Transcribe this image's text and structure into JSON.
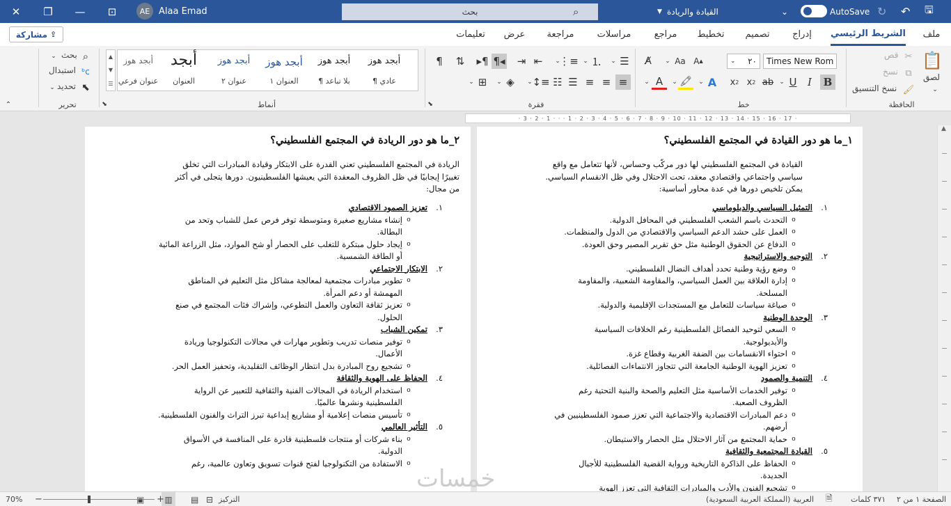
{
  "titlebar": {
    "close": "✕",
    "restore": "❐",
    "minimize": "—",
    "options": "⊡",
    "user_initials": "AE",
    "user_name": "Alaa Emad",
    "search_placeholder": "بحث",
    "doc_title": "القيادة والريادة",
    "autosave": "AutoSave"
  },
  "tabs": [
    "ملف",
    "الشريط الرئيسي",
    "إدراج",
    "تصميم",
    "تخطيط",
    "مراجع",
    "مراسلات",
    "مراجعة",
    "عرض",
    "تعليمات"
  ],
  "share": "مشاركة",
  "clipboard": {
    "paste": "لصق",
    "cut": "قص",
    "copy": "نسخ",
    "format_painter": "نسخ التنسيق",
    "label": "الحافظة"
  },
  "font": {
    "name": "Times New Rom",
    "size": "٢٠",
    "label": "خط"
  },
  "paragraph": {
    "label": "فقرة"
  },
  "styles": {
    "label": "أنماط",
    "items": [
      {
        "preview": "أبجد هوز",
        "name": "¶ عادي"
      },
      {
        "preview": "أبجد هوز",
        "name": "¶ بلا تباعد"
      },
      {
        "preview": "أبجد هوز",
        "name": "العنوان ١"
      },
      {
        "preview": "أبجد هوز",
        "name": "عنوان ٢"
      },
      {
        "preview": "أبجد",
        "name": "العنوان"
      },
      {
        "preview": "أبجد هوز",
        "name": "عنوان فرعي"
      }
    ]
  },
  "editing": {
    "find": "بحث",
    "replace": "استبدال",
    "select": "تحديد",
    "label": "تحرير"
  },
  "ruler_text": "· 3 · 2 · 1 · · · 1 · 2 · 3 · 4 · 5 · 6 · 7 · 8 · 9 · 10 · 11 · 12 · 13 · 14 · 15 · 16 · 17 ·",
  "page1": {
    "title": "١_ما هو دور القيادة في المجتمع الفلسطيني؟",
    "intro": "القيادة في المجتمع الفلسطيني لها دور مركّب وحساس، لأنها تتعامل مع واقع سياسي واجتماعي واقتصادي معقد، تحت الاحتلال وفي ظل الانقسام السياسي. يمكن تلخيص دورها في عدة محاور أساسية:",
    "sections": [
      {
        "num": "١.",
        "title": "التمثيل السياسي والدبلوماسي",
        "bullets": [
          "التحدث باسم الشعب الفلسطيني في المحافل الدولية.",
          "العمل على حشد الدعم السياسي والاقتصادي من الدول والمنظمات.",
          "الدفاع عن الحقوق الوطنية مثل حق تقرير المصير وحق العودة."
        ]
      },
      {
        "num": "٢.",
        "title": "التوجيه والاستراتيجية",
        "bullets": [
          "وضع رؤية وطنية تحدد أهداف النضال الفلسطيني.",
          "إدارة العلاقة بين العمل السياسي، والمقاومة الشعبية، والمقاومة المسلحة.",
          "صياغة سياسات للتعامل مع المستجدات الإقليمية والدولية."
        ]
      },
      {
        "num": "٣.",
        "title": "الوحدة الوطنية",
        "bullets": [
          "السعي لتوحيد الفصائل الفلسطينية رغم الخلافات السياسية والأيديولوجية.",
          "احتواء الانقسامات بين الضفة الغربية وقطاع غزة.",
          "تعزيز الهوية الوطنية الجامعة التي تتجاوز الانتماءات الفصائلية."
        ]
      },
      {
        "num": "٤.",
        "title": "التنمية والصمود",
        "bullets": [
          "توفير الخدمات الأساسية مثل التعليم والصحة والبنية التحتية رغم الظروف الصعبة.",
          "دعم المبادرات الاقتصادية والاجتماعية التي تعزز صمود الفلسطينيين في أرضهم.",
          "حماية المجتمع من آثار الاحتلال مثل الحصار والاستيطان."
        ]
      },
      {
        "num": "٥.",
        "title": "القيادة المجتمعية والثقافية",
        "bullets": [
          "الحفاظ على الذاكرة التاريخية ورواية القضية الفلسطينية للأجيال الجديدة.",
          "تشجيع الفنون والأدب والمبادرات الثقافية التي تعزز الهوية"
        ]
      }
    ]
  },
  "page2": {
    "title": "٢_ما هو دور الريادة في المجتمع الفلسطيني؟",
    "intro": "الريادة في المجتمع الفلسطيني تعني القدرة على الابتكار وقيادة المبادرات التي تخلق تغييرًا إيجابيًا في ظل الظروف المعقدة التي يعيشها الفلسطينيون. دورها يتجلى في أكثر من مجال:",
    "sections": [
      {
        "num": "١.",
        "title": "تعزيز الصمود الاقتصادي",
        "bullets": [
          "إنشاء مشاريع صغيرة ومتوسطة توفر فرص عمل للشباب وتحد من البطالة.",
          "إيجاد حلول مبتكرة للتغلب على الحصار أو شح الموارد، مثل الزراعة المائية أو الطاقة الشمسية."
        ]
      },
      {
        "num": "٢.",
        "title": "الابتكار الاجتماعي",
        "bullets": [
          "تطوير مبادرات مجتمعية لمعالجة مشاكل مثل التعليم في المناطق المهمشة أو دعم المرأة.",
          "تعزيز ثقافة التعاون والعمل التطوعي، وإشراك فئات المجتمع في صنع الحلول."
        ]
      },
      {
        "num": "٣.",
        "title": "تمكين الشباب",
        "bullets": [
          "توفير منصات تدريب وتطوير مهارات في مجالات التكنولوجيا وريادة الأعمال.",
          "تشجيع روح المبادرة بدل انتظار الوظائف التقليدية، وتحفيز العمل الحر."
        ]
      },
      {
        "num": "٤.",
        "title": "الحفاظ على الهوية والثقافة",
        "bullets": [
          "استخدام الريادة في المجالات الفنية والثقافية للتعبير عن الرواية الفلسطينية ونشرها عالميًا.",
          "تأسيس منصات إعلامية أو مشاريع إبداعية تبرز التراث والفنون الفلسطينية."
        ]
      },
      {
        "num": "٥.",
        "title": "التأثير العالمي",
        "bullets": [
          "بناء شركات أو منتجات فلسطينية قادرة على المنافسة في الأسواق الدولية.",
          "الاستفادة من التكنولوجيا لفتح قنوات تسويق وتعاون عالمية، رغم"
        ]
      }
    ]
  },
  "watermark": "خمسات",
  "status": {
    "page": "الصفحة ١ من ٢",
    "words": "٣٧١ كلمات",
    "language": "العربية (المملكة العربية السعودية)",
    "focus": "التركيز",
    "zoom": "70%"
  }
}
